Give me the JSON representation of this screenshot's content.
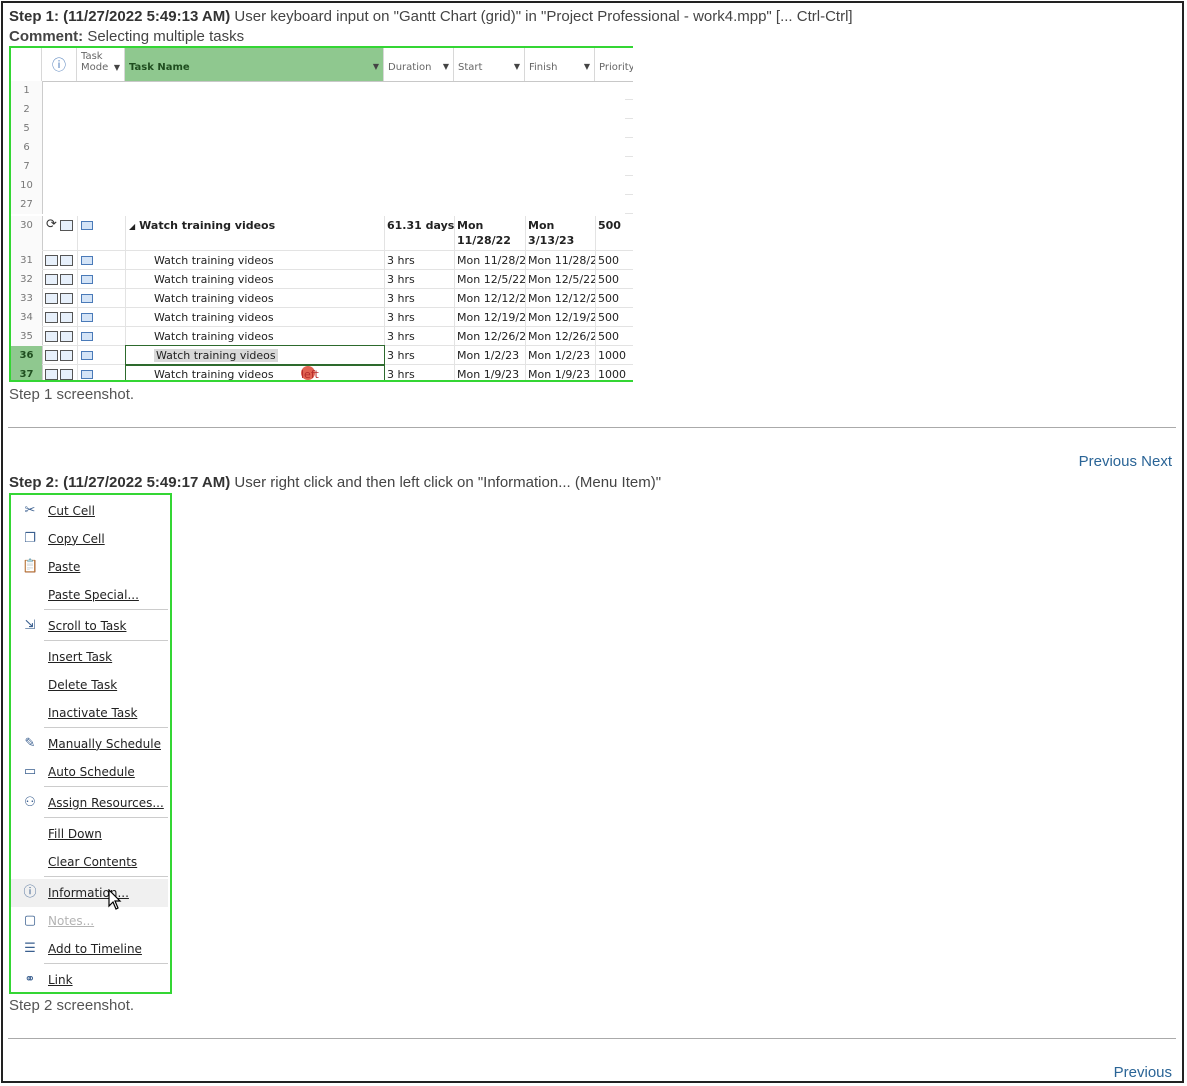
{
  "step1": {
    "header_bold": "Step 1: (11/27/2022 5:49:13 AM)",
    "header_text": " User keyboard input on \"Gantt Chart (grid)\" in \"Project Professional - work4.mpp\" [... Ctrl-Ctrl]",
    "comment_label": "Comment:",
    "comment_text": " Selecting multiple tasks",
    "caption": "Step 1 screenshot."
  },
  "gantt": {
    "columns": {
      "info_icon": "ⓘ",
      "task_mode": "Task Mode",
      "task_name": "Task Name",
      "duration": "Duration",
      "start": "Start",
      "finish": "Finish",
      "priority": "Priority"
    },
    "empty_rows": [
      "1",
      "2",
      "5",
      "6",
      "7",
      "10",
      "27"
    ],
    "summary": {
      "id": "30",
      "name": "Watch training videos",
      "duration": "61.31 days",
      "start_l1": "Mon",
      "start_l2": "11/28/22",
      "finish_l1": "Mon",
      "finish_l2": "3/13/23",
      "priority": "500"
    },
    "rows": [
      {
        "id": "31",
        "name": "Watch training videos",
        "duration": "3 hrs",
        "start": "Mon 11/28/2",
        "finish": "Mon 11/28/2",
        "priority": "500"
      },
      {
        "id": "32",
        "name": "Watch training videos",
        "duration": "3 hrs",
        "start": "Mon 12/5/22",
        "finish": "Mon 12/5/22",
        "priority": "500"
      },
      {
        "id": "33",
        "name": "Watch training videos",
        "duration": "3 hrs",
        "start": "Mon 12/12/2",
        "finish": "Mon 12/12/2",
        "priority": "500"
      },
      {
        "id": "34",
        "name": "Watch training videos",
        "duration": "3 hrs",
        "start": "Mon 12/19/2",
        "finish": "Mon 12/19/2",
        "priority": "500"
      },
      {
        "id": "35",
        "name": "Watch training videos",
        "duration": "3 hrs",
        "start": "Mon 12/26/2",
        "finish": "Mon 12/26/2",
        "priority": "500"
      },
      {
        "id": "36",
        "name": "Watch training videos",
        "duration": "3 hrs",
        "start": "Mon 1/2/23",
        "finish": "Mon 1/2/23",
        "priority": "1000",
        "selected": true
      },
      {
        "id": "37",
        "name": "Watch training videos",
        "duration": "3 hrs",
        "start": "Mon 1/9/23",
        "finish": "Mon 1/9/23",
        "priority": "1000",
        "selected": true
      }
    ],
    "click_marker": "left"
  },
  "nav1": {
    "previous": "Previous",
    "next": "Next"
  },
  "step2": {
    "header_bold": "Step 2: (11/27/2022 5:49:17 AM)",
    "header_text": " User right click and then left click on \"Information... (Menu Item)\"",
    "caption": "Step 2 screenshot."
  },
  "menu": {
    "items": [
      {
        "label": "Cut Cell",
        "icon": "scissors-icon"
      },
      {
        "label": "Copy Cell",
        "icon": "copy-icon"
      },
      {
        "label": "Paste",
        "icon": "paste-icon"
      },
      {
        "label": "Paste Special...",
        "icon": ""
      },
      {
        "label": "Scroll to Task",
        "icon": "scroll-to-task-icon"
      },
      {
        "label": "Insert Task",
        "icon": ""
      },
      {
        "label": "Delete Task",
        "icon": ""
      },
      {
        "label": "Inactivate Task",
        "icon": ""
      },
      {
        "label": "Manually Schedule",
        "icon": "pin-icon"
      },
      {
        "label": "Auto Schedule",
        "icon": "auto-schedule-icon"
      },
      {
        "label": "Assign Resources...",
        "icon": "people-icon"
      },
      {
        "label": "Fill Down",
        "icon": ""
      },
      {
        "label": "Clear Contents",
        "icon": ""
      },
      {
        "label": "Information...",
        "icon": "information-icon",
        "hover": true
      },
      {
        "label": "Notes...",
        "icon": "notes-icon",
        "disabled": true
      },
      {
        "label": "Add to Timeline",
        "icon": "timeline-icon"
      },
      {
        "label": "Link",
        "icon": "link-icon"
      }
    ]
  },
  "nav2": {
    "previous": "Previous"
  }
}
